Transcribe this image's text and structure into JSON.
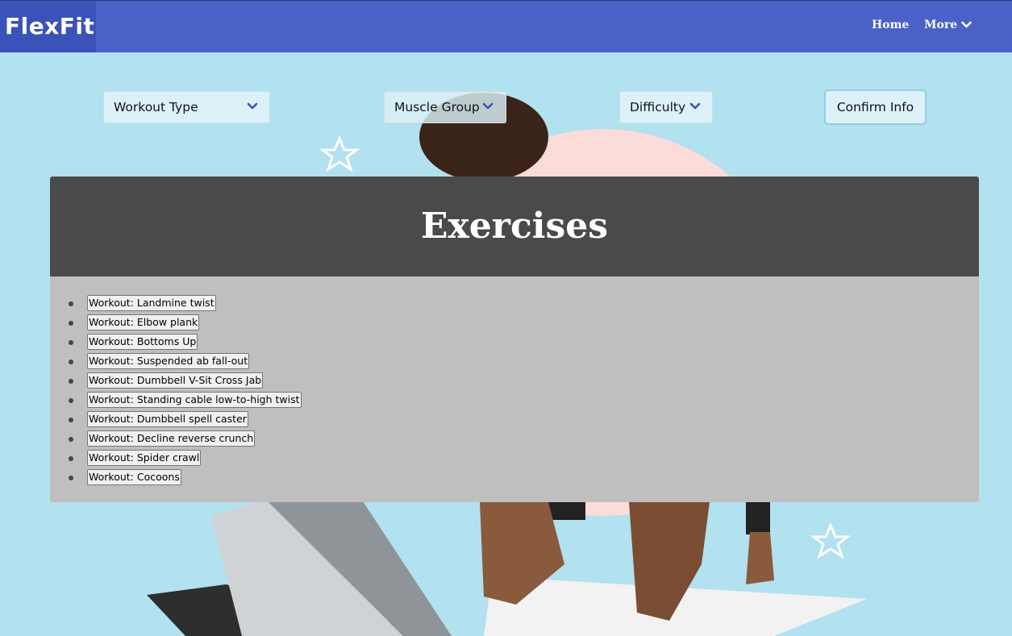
{
  "navbar": {
    "brand": "FlexFit",
    "links": [
      {
        "label": "Home"
      },
      {
        "label": "More",
        "icon": "chevron-down-icon"
      }
    ]
  },
  "filters": {
    "workout_type": "Workout Type",
    "muscle_group": "Muscle Group",
    "difficulty": "Difficulty",
    "confirm_label": "Confirm Info",
    "chevron_icon": "chevron-down-icon"
  },
  "exercises": {
    "title": "Exercises",
    "items": [
      "Workout: Landmine twist",
      "Workout: Elbow plank",
      "Workout: Bottoms Up",
      "Workout: Suspended ab fall-out",
      "Workout: Dumbbell V-Sit Cross Jab",
      "Workout: Standing cable low-to-high twist",
      "Workout: Dumbbell spell caster",
      "Workout: Decline reverse crunch",
      "Workout: Spider crawl",
      "Workout: Cocoons"
    ]
  },
  "colors": {
    "background": "#b2e1ef",
    "navbar": "#4a61c8",
    "accent": "#3b52b8",
    "panel_header": "#4a4a4a",
    "panel_body": "#bfbfbf"
  }
}
